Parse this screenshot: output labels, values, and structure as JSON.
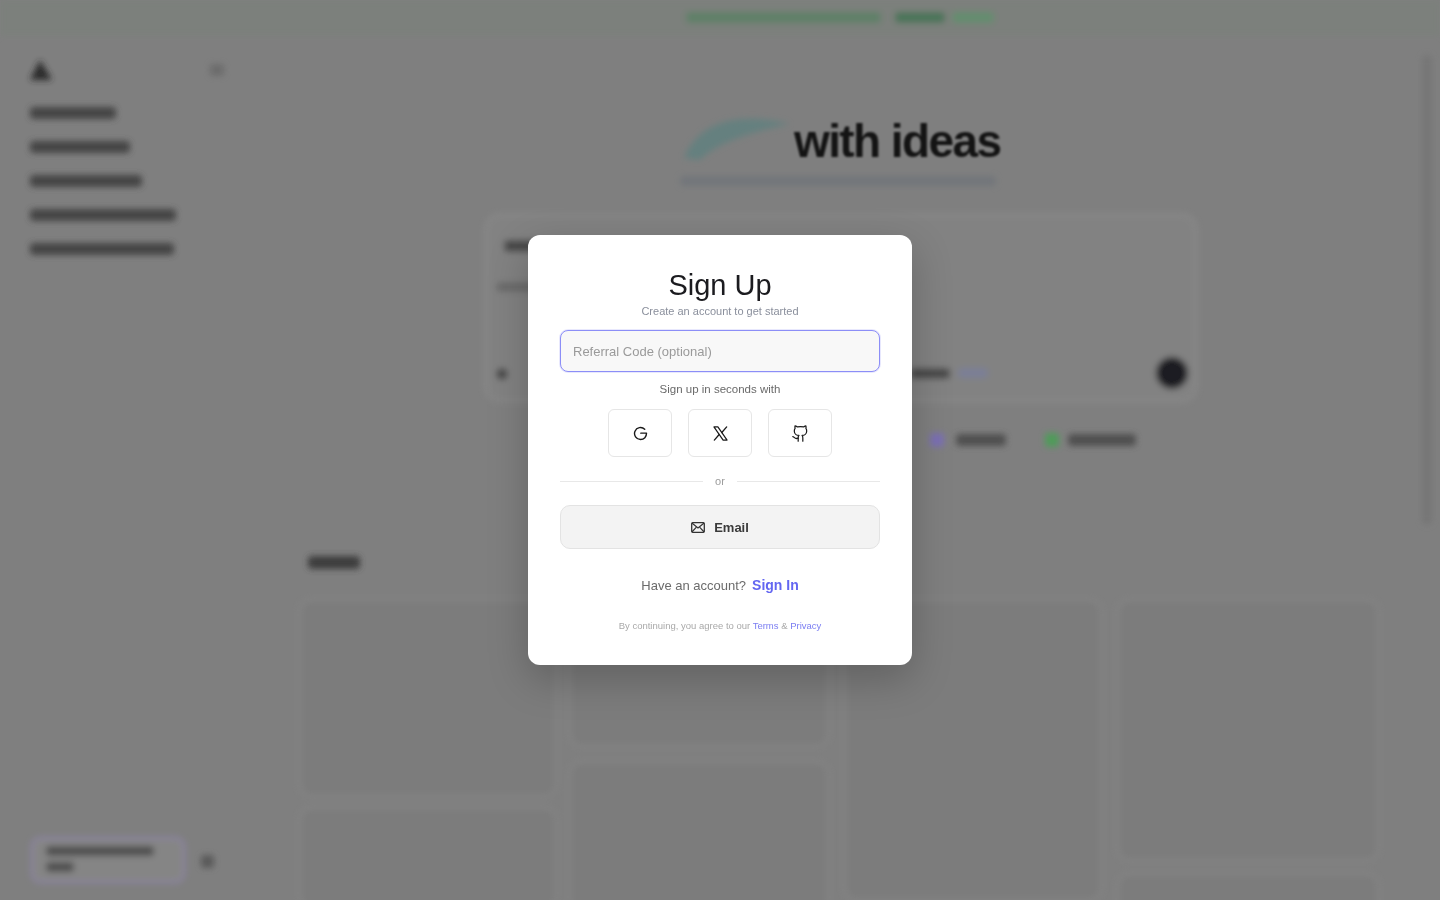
{
  "backdrop": {
    "heading": "with ideas"
  },
  "dialog": {
    "title": "Sign Up",
    "subtitle": "Create an account to get started",
    "referral_field": {
      "placeholder": "Referral Code (optional)",
      "focused": true
    },
    "social_prompt": "Sign up in seconds with",
    "social_buttons": [
      {
        "kind": "google"
      },
      {
        "kind": "x"
      },
      {
        "kind": "github"
      }
    ],
    "divider": "or",
    "email_button": "Email",
    "signin_prompt": {
      "text": "Have an account?",
      "link": "Sign In"
    },
    "legal": {
      "text": "By continuing, you agree to our",
      "links": [
        "Terms",
        "Privacy"
      ],
      "joiner": "&"
    }
  }
}
